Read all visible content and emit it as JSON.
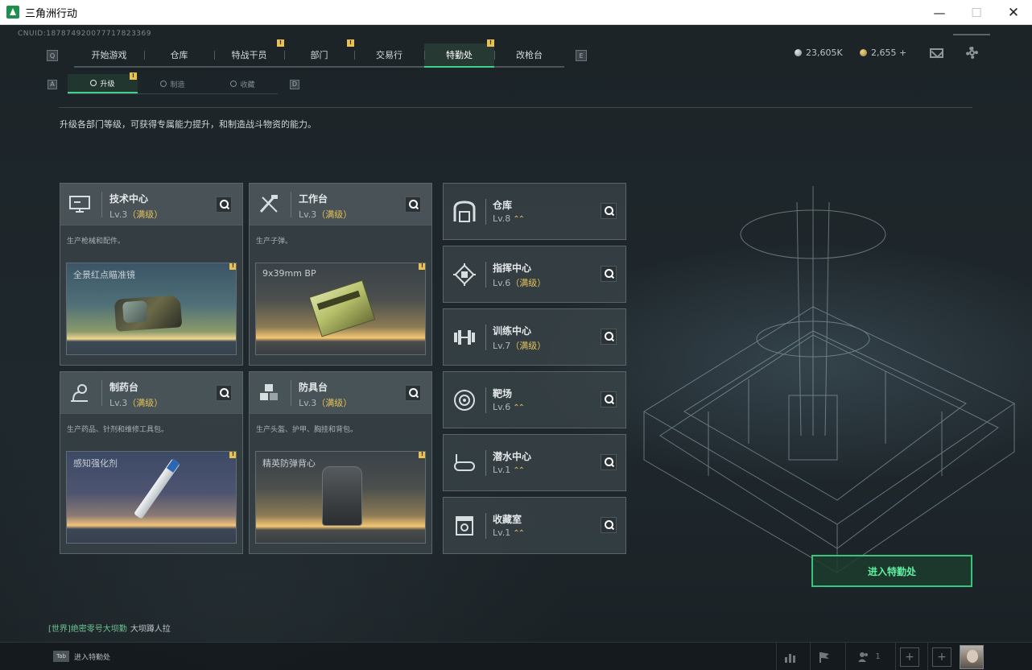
{
  "window": {
    "title": "三角洲行动",
    "minimize": "—",
    "maximize": "☐",
    "close": "✕"
  },
  "uid": "CNUID:187874920077717823369",
  "nav": {
    "key_q": "Q",
    "key_e": "E",
    "tabs": [
      {
        "label": "开始游戏",
        "notif": ""
      },
      {
        "label": "仓库",
        "notif": ""
      },
      {
        "label": "特战干员",
        "notif": "!"
      },
      {
        "label": "部门",
        "notif": "!"
      },
      {
        "label": "交易行",
        "notif": ""
      },
      {
        "label": "特勤处",
        "notif": "!",
        "active": true
      },
      {
        "label": "改枪台",
        "notif": ""
      }
    ]
  },
  "currency": {
    "silver": "23,605K",
    "gold": "2,655 +"
  },
  "sub_nav": {
    "key_a": "A",
    "key_d": "D",
    "tabs": [
      {
        "label": "升级",
        "notif": "!",
        "active": true
      },
      {
        "label": "制造",
        "notif": ""
      },
      {
        "label": "收藏",
        "notif": ""
      }
    ]
  },
  "description": "升级各部门等级，可获得专属能力提升，和制造战斗物资的能力。",
  "big_cards": [
    {
      "name": "技术中心",
      "level": "Lv.3",
      "max": "（满级）",
      "desc": "生产枪械和配件。",
      "item": "全景红点瞄准镜",
      "icon": "monitor-icon"
    },
    {
      "name": "工作台",
      "level": "Lv.3",
      "max": "（满级）",
      "desc": "生产子弹。",
      "item": "9x39mm BP",
      "icon": "tools-icon"
    },
    {
      "name": "制药台",
      "level": "Lv.3",
      "max": "（满级）",
      "desc": "生产药品、针剂和维修工具包。",
      "item": "感知强化剂",
      "icon": "microscope-icon"
    },
    {
      "name": "防具台",
      "level": "Lv.3",
      "max": "（满级）",
      "desc": "生产头盔、护甲、胸挂和背包。",
      "item": "精英防弹背心",
      "icon": "blocks-icon"
    }
  ],
  "right_cards": [
    {
      "name": "仓库",
      "level": "Lv.8",
      "max": "",
      "upgrade": "⌃⌃",
      "icon": "warehouse-icon"
    },
    {
      "name": "指挥中心",
      "level": "Lv.6",
      "max": "（满级）",
      "upgrade": "",
      "icon": "chip-icon"
    },
    {
      "name": "训练中心",
      "level": "Lv.7",
      "max": "（满级）",
      "upgrade": "",
      "icon": "dumbbell-icon"
    },
    {
      "name": "靶场",
      "level": "Lv.6",
      "max": "",
      "upgrade": "⌃⌃",
      "icon": "target-icon"
    },
    {
      "name": "潜水中心",
      "level": "Lv.1",
      "max": "",
      "upgrade": "⌃⌃",
      "icon": "goggles-icon"
    },
    {
      "name": "收藏室",
      "level": "Lv.1",
      "max": "",
      "upgrade": "⌃⌃",
      "icon": "trophy-icon"
    }
  ],
  "enter_button": "进入特勤处",
  "chat": {
    "channel": "[世界]",
    "sender": "绝密零号大坝勤",
    "message": "大坝蹲人拉"
  },
  "bottom": {
    "tab_key": "Tab",
    "tab_hint": "进入特勤处",
    "team_count": "1"
  },
  "colors": {
    "accent_green": "#3fd38a",
    "max_gold": "#e2c15a"
  }
}
